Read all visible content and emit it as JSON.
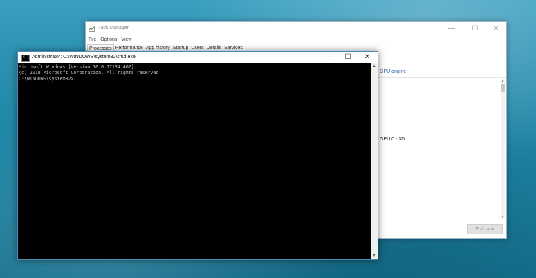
{
  "task_manager": {
    "title": "Task Manager",
    "controls": {
      "minimize": "—",
      "maximize": "☐",
      "close": "✕"
    },
    "menu": [
      "File",
      "Options",
      "View"
    ],
    "tabs": [
      "Processes",
      "Performance",
      "App history",
      "Startup",
      "Users",
      "Details",
      "Services"
    ],
    "active_tab": "Processes",
    "column_header": "GPU engine",
    "cell_value": "GPU 0 - 3D",
    "end_task_label": "End task"
  },
  "cmd": {
    "title": "Administrator: C:\\WINDOWS\\system32\\cmd.exe",
    "controls": {
      "minimize": "—",
      "maximize": "☐",
      "close": "✕"
    },
    "lines": [
      "Microsoft Windows [Version 10.0.17134.407]",
      "(c) 2018 Microsoft Corporation. All rights reserved.",
      "",
      "C:\\WINDOWS\\system32>"
    ]
  }
}
